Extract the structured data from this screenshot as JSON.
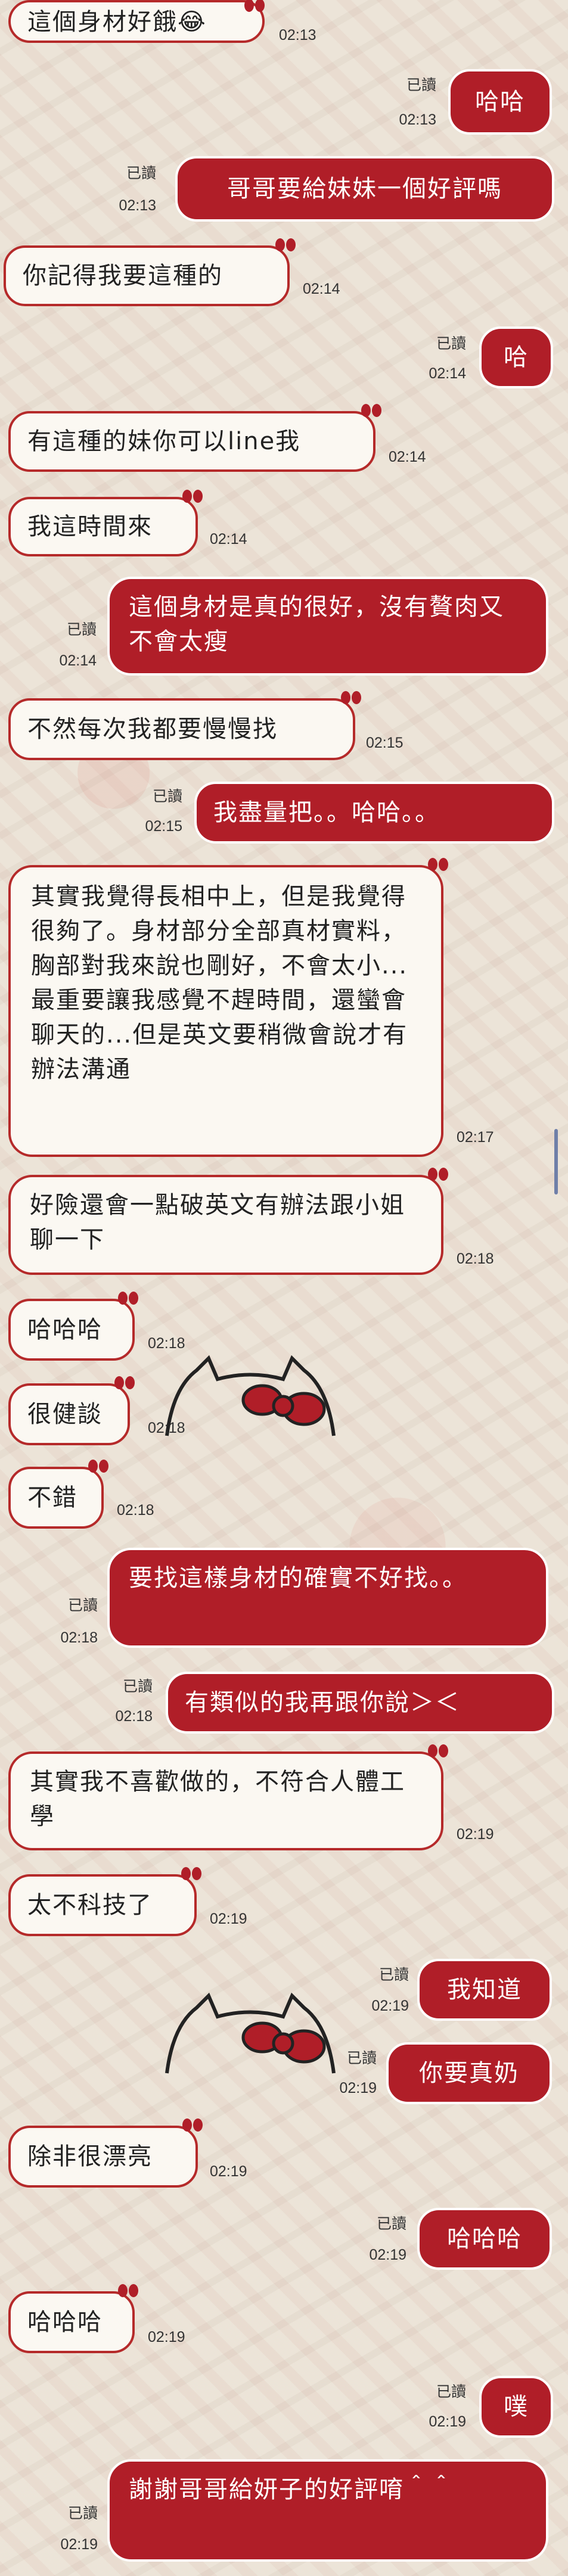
{
  "messages": [
    {
      "side": "left",
      "text": "這個身材好餓😂",
      "time": "02:13"
    },
    {
      "side": "right",
      "text": "哈哈",
      "read": "已讀",
      "time": "02:13"
    },
    {
      "side": "right",
      "text": "哥哥要給妹妹一個好評嗎",
      "read": "已讀",
      "time": "02:13"
    },
    {
      "side": "left",
      "text": "你記得我要這種的",
      "time": "02:14"
    },
    {
      "side": "right",
      "text": "哈",
      "read": "已讀",
      "time": "02:14"
    },
    {
      "side": "left",
      "text": "有這種的妹你可以line我",
      "time": "02:14"
    },
    {
      "side": "left",
      "text": "我這時間來",
      "time": "02:14"
    },
    {
      "side": "right",
      "text": "這個身材是真的很好，沒有贅肉又不會太瘦",
      "read": "已讀",
      "time": "02:14"
    },
    {
      "side": "left",
      "text": "不然每次我都要慢慢找",
      "time": "02:15"
    },
    {
      "side": "right",
      "text": "我盡量把。。哈哈。。",
      "read": "已讀",
      "time": "02:15"
    },
    {
      "side": "left",
      "text": "其實我覺得長相中上，但是我覺得很夠了。身材部分全部真材實料，胸部對我來說也剛好，不會太小...最重要讓我感覺不趕時間，還蠻會聊天的...但是英文要稍微會說才有辦法溝通",
      "time": "02:17"
    },
    {
      "side": "left",
      "text": "好險還會一點破英文有辦法跟小姐聊一下",
      "time": "02:18"
    },
    {
      "side": "left",
      "text": "哈哈哈",
      "time": "02:18"
    },
    {
      "side": "left",
      "type": "sticker",
      "sticker": "hello-kitty-peek-sticker",
      "time": "02:18"
    },
    {
      "side": "left",
      "text": "很健談",
      "time": ""
    },
    {
      "side": "left",
      "text": "不錯",
      "time": "02:18"
    },
    {
      "side": "right",
      "text": "要找這樣身材的確實不好找。。",
      "read": "已讀",
      "time": "02:18"
    },
    {
      "side": "right",
      "text": "有類似的我再跟你說＞＜",
      "read": "已讀",
      "time": "02:18"
    },
    {
      "side": "left",
      "text": "其實我不喜歡做的，不符合人體工學",
      "time": "02:19"
    },
    {
      "side": "left",
      "text": "太不科技了",
      "time": "02:19"
    },
    {
      "side": "right",
      "text": "我知道",
      "read": "已讀",
      "time": "02:19"
    },
    {
      "side": "right",
      "type": "sticker",
      "sticker": "hello-kitty-peek-sticker",
      "read": "",
      "time": ""
    },
    {
      "side": "right",
      "text": "你要真奶",
      "read": "已讀",
      "time": "02:19"
    },
    {
      "side": "left",
      "text": "除非很漂亮",
      "time": "02:19"
    },
    {
      "side": "right",
      "text": "哈哈哈",
      "read": "已讀",
      "time": "02:19"
    },
    {
      "side": "left",
      "text": "哈哈哈",
      "time": "02:19"
    },
    {
      "side": "right",
      "text": "噗",
      "read": "已讀",
      "time": "02:19"
    },
    {
      "side": "right",
      "text": "謝謝哥哥給妍子的好評唷＾＾",
      "read": "已讀",
      "time": "02:19"
    }
  ],
  "colors": {
    "accent": "#b01e28",
    "bubble_left": "#fbf8f2",
    "border_left": "#b52a2a"
  }
}
